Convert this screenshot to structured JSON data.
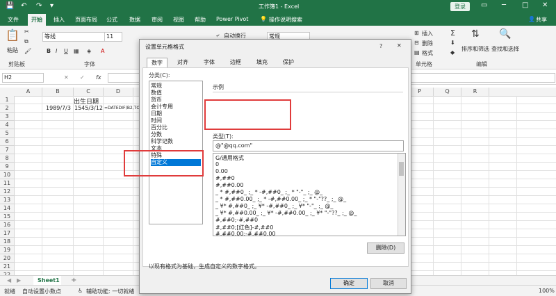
{
  "titlebar": {
    "title": "工作簿1 - Excel",
    "login": "登录",
    "quick_access": [
      "💾",
      "↶",
      "↷",
      "▾"
    ],
    "window_controls": [
      "▭",
      "─",
      "□",
      "✕"
    ]
  },
  "menu": {
    "tabs": [
      "文件",
      "开始",
      "插入",
      "页面布局",
      "公式",
      "数据",
      "审阅",
      "视图",
      "帮助",
      "Power Pivot"
    ],
    "help_search": "操作说明搜索",
    "share": "共享"
  },
  "ribbon": {
    "paste": "粘贴",
    "clipboard": "剪贴板",
    "font_name": "等线",
    "font_size": "11",
    "font_group": "字体",
    "wrap_text": "自动换行",
    "number_format": "常规",
    "insert": "插入",
    "delete": "删除",
    "format": "格式",
    "cells_group": "单元格",
    "sort_filter": "排序和筛选",
    "find_select": "查找和选择",
    "edit_group": "编辑",
    "bold": "B",
    "italic": "I",
    "underline": "U",
    "sum": "Σ"
  },
  "formula_bar": {
    "name_box": "H2",
    "fx": "fx",
    "cancel": "✕",
    "confirm": "✓"
  },
  "grid": {
    "columns": [
      "A",
      "B",
      "C",
      "D",
      "P",
      "Q",
      "R"
    ],
    "rows": [
      "1",
      "2",
      "3",
      "4",
      "5",
      "6",
      "7",
      "8",
      "9",
      "10",
      "11",
      "12",
      "13",
      "14",
      "15",
      "16",
      "17",
      "18",
      "19",
      "20",
      "21",
      "22"
    ],
    "cells": {
      "b1": "出生日期",
      "b2": "1989/7/3",
      "c2": "1545/3/12",
      "d2": "=DATEDIF(B2,TO"
    }
  },
  "sheets": {
    "tab": "Sheet1",
    "add": "+"
  },
  "status": {
    "ready": "就绪",
    "autodecimal": "自动设置小数点",
    "accessibility": "辅助功能: 一切就绪",
    "zoom": "100%"
  },
  "dialog": {
    "title": "设置单元格格式",
    "help": "?",
    "close": "✕",
    "tabs": [
      "数字",
      "对齐",
      "字体",
      "边框",
      "填充",
      "保护"
    ],
    "category_label": "分类(C):",
    "categories": [
      "常规",
      "数值",
      "货币",
      "会计专用",
      "日期",
      "时间",
      "百分比",
      "分数",
      "科学记数",
      "文本",
      "特殊",
      "自定义"
    ],
    "selected_category": "自定义",
    "sample_label": "示例",
    "type_label": "类型(T):",
    "type_value": "@\"@qq.com\"",
    "formats": [
      "G/通用格式",
      "0",
      "0.00",
      "#,##0",
      "#,##0.00",
      "_ * #,##0_ ;_ * -#,##0_ ;_ * \"-\"_ ;_ @_",
      "_ * #,##0.00_ ;_ * -#,##0.00_ ;_ * \"-\"??_ ;_ @_",
      "_ ¥* #,##0_ ;_ ¥* -#,##0_ ;_ ¥* \"-\"_ ;_ @_",
      "_ ¥* #,##0.00_ ;_ ¥* -#,##0.00_ ;_ ¥* \"-\"??_ ;_ @_",
      "#,##0;-#,##0",
      "#,##0;[红色]-#,##0",
      "#,##0.00;-#,##0.00"
    ],
    "delete_button": "删除(D)",
    "description": "以现有格式为基础，生成自定义的数字格式。",
    "ok_button": "确定",
    "cancel_button": "取消"
  },
  "colors": {
    "excel_green": "#217346",
    "highlight_red": "#e03b3b",
    "selection_blue": "#0078d7"
  }
}
